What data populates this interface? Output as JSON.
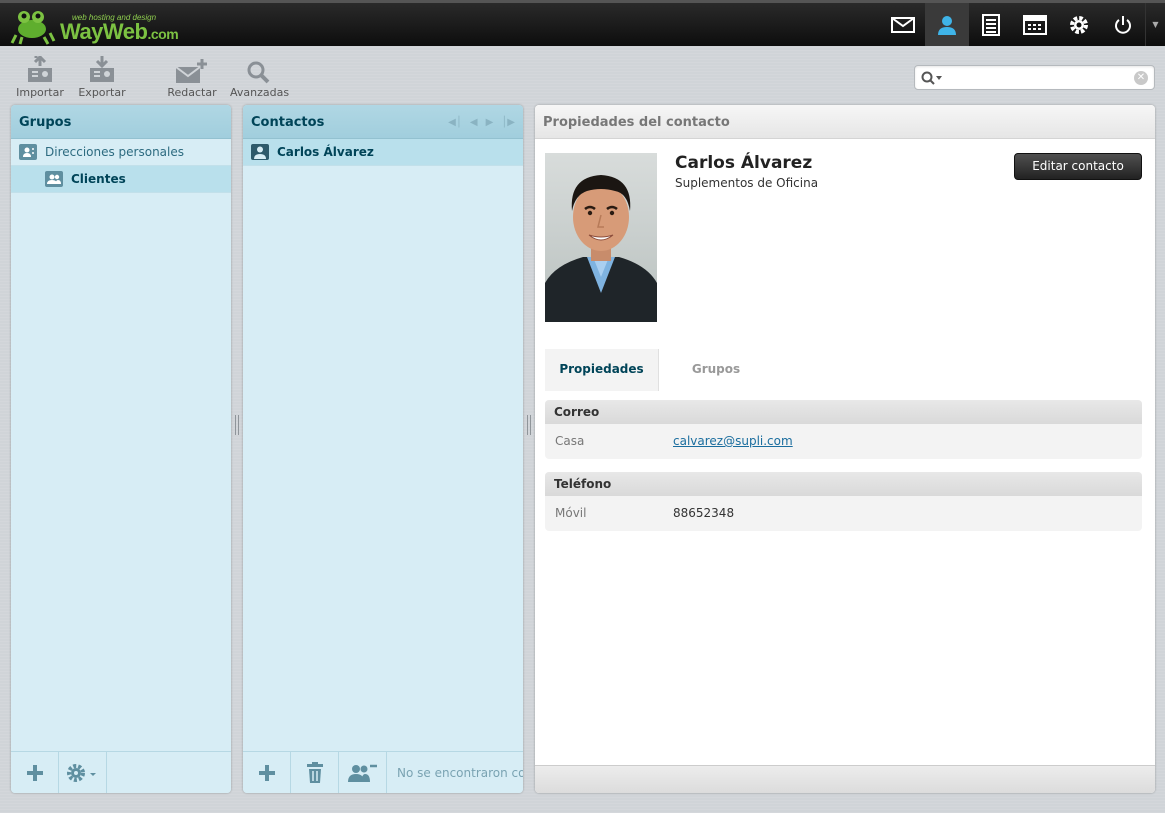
{
  "brand": {
    "name": "WayWeb",
    "suffix": ".com",
    "tagline": "web hosting and design"
  },
  "topnav": [
    {
      "icon": "mail-icon"
    },
    {
      "icon": "contacts-icon"
    },
    {
      "icon": "notes-icon"
    },
    {
      "icon": "calendar-icon"
    },
    {
      "icon": "gear-icon"
    },
    {
      "icon": "power-icon"
    }
  ],
  "toolbar": {
    "import_label": "Importar",
    "export_label": "Exportar",
    "compose_label": "Redactar",
    "advanced_label": "Avanzadas"
  },
  "search": {
    "value": "",
    "placeholder": ""
  },
  "groups": {
    "title": "Grupos",
    "items": [
      {
        "label": "Direcciones personales"
      },
      {
        "label": "Clientes"
      }
    ]
  },
  "contacts": {
    "title": "Contactos",
    "items": [
      {
        "label": "Carlos Álvarez"
      }
    ],
    "footer_message": "No se encontraron co"
  },
  "properties": {
    "title": "Propiedades del contacto",
    "name": "Carlos Álvarez",
    "organization": "Suplementos de Oficina",
    "edit_label": "Editar contacto",
    "tabs": [
      {
        "label": "Propiedades"
      },
      {
        "label": "Grupos"
      }
    ],
    "email_section": {
      "title": "Correo",
      "key": "Casa",
      "value": "calvarez@supli.com"
    },
    "phone_section": {
      "title": "Teléfono",
      "key": "Móvil",
      "value": "88652348"
    }
  },
  "colors": {
    "accent": "#004458",
    "brand_green": "#7cc242",
    "panel_bg": "#d7edf5"
  }
}
